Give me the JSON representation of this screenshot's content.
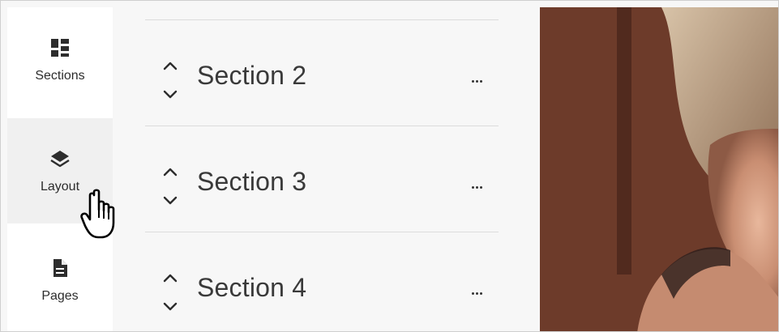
{
  "rail": {
    "items": [
      {
        "label": "Sections",
        "icon": "sections-grid-icon"
      },
      {
        "label": "Layout",
        "icon": "layers-icon",
        "active": true
      },
      {
        "label": "Pages",
        "icon": "page-document-icon"
      }
    ]
  },
  "sections": [
    {
      "label": "Section 2"
    },
    {
      "label": "Section 3"
    },
    {
      "label": "Section 4"
    }
  ],
  "colors": {
    "rail_bg": "#ffffff",
    "active_bg": "#f0f0f0",
    "panel_bg": "#f7f7f7",
    "text": "#3a3a3a",
    "divider": "#dcdcdc"
  }
}
